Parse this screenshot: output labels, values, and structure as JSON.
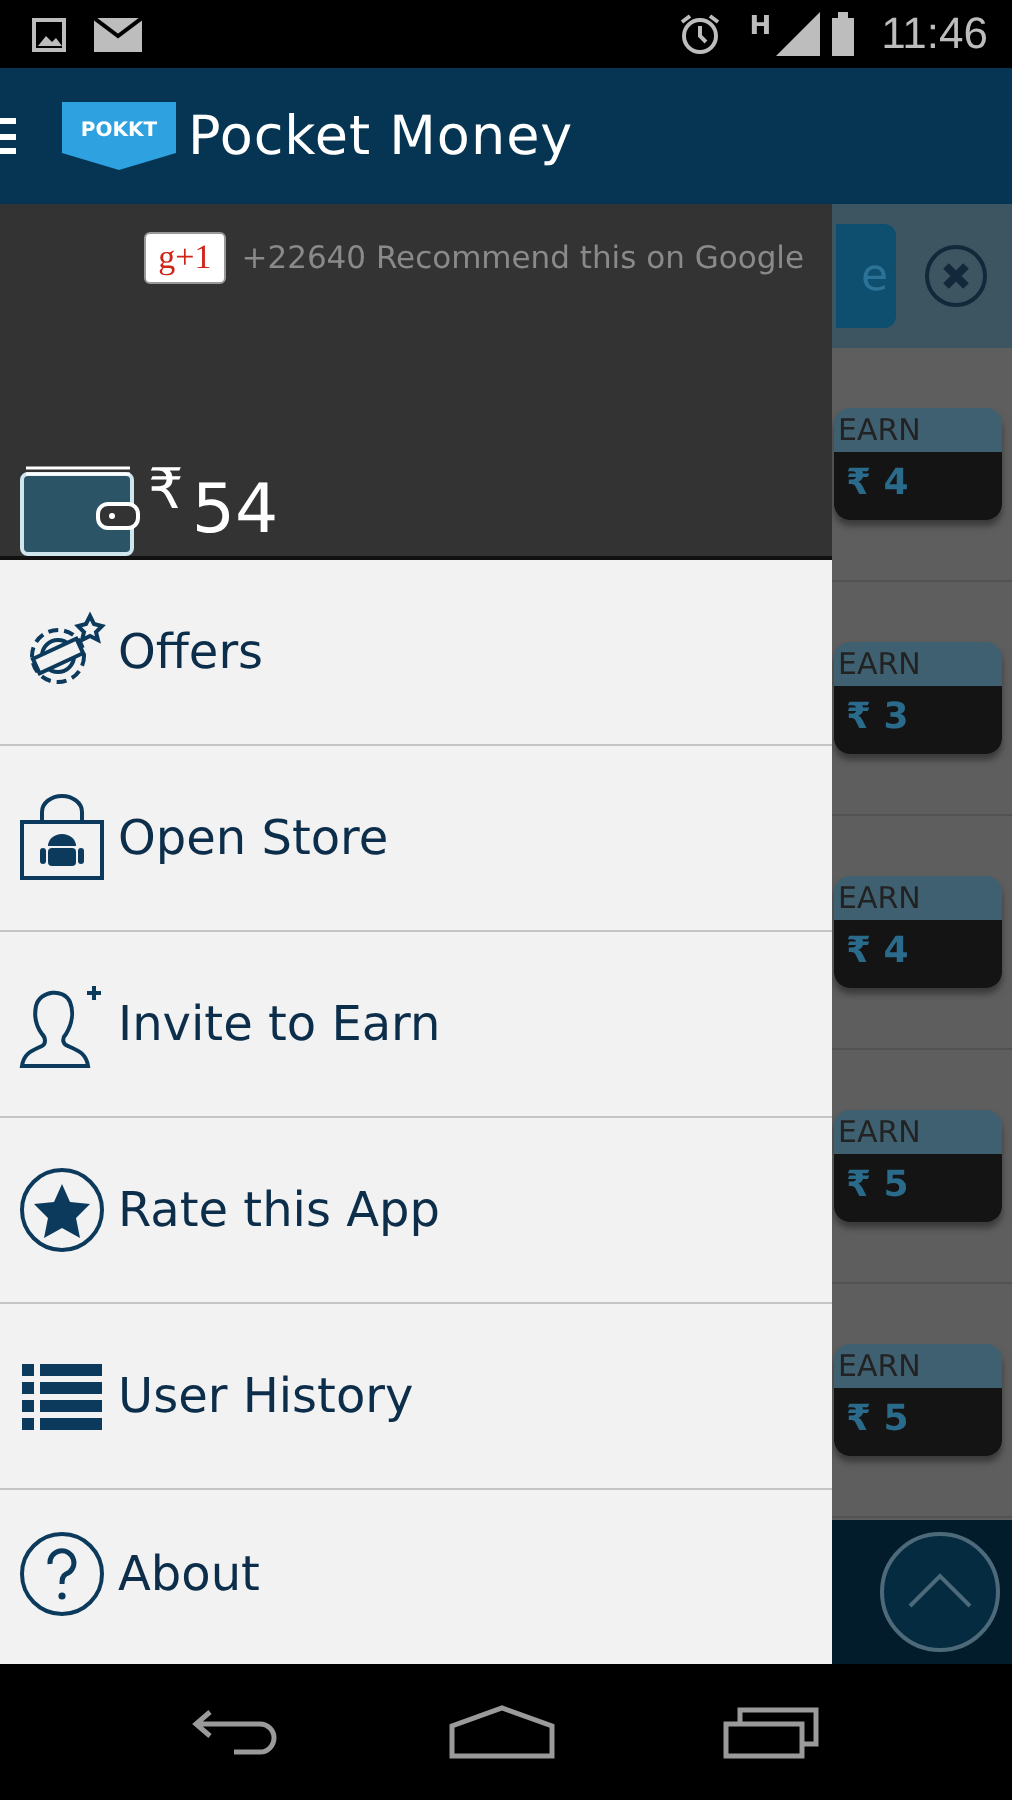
{
  "status_bar": {
    "network": "H",
    "time": "11:46"
  },
  "app_bar": {
    "logo_badge": "POKKT",
    "title": "Pocket Money"
  },
  "background": {
    "button_text": "e",
    "offers": [
      {
        "label": "EARN",
        "amount": "₹ 4"
      },
      {
        "label": "EARN",
        "amount": "₹ 3"
      },
      {
        "label": "EARN",
        "amount": "₹ 4"
      },
      {
        "label": "EARN",
        "amount": "₹ 5"
      },
      {
        "label": "EARN",
        "amount": "₹ 5"
      }
    ]
  },
  "drawer": {
    "plus_one": {
      "badge": "g+1",
      "text": "+22640 Recommend this on Google"
    },
    "balance": {
      "currency": "₹",
      "amount": "54"
    },
    "menu": [
      {
        "kind": "offers",
        "label": "Offers"
      },
      {
        "kind": "store",
        "label": "Open Store"
      },
      {
        "kind": "invite",
        "label": "Invite to Earn"
      },
      {
        "kind": "rate",
        "label": "Rate this App"
      },
      {
        "kind": "history",
        "label": "User History"
      },
      {
        "kind": "about",
        "label": "About"
      }
    ]
  }
}
